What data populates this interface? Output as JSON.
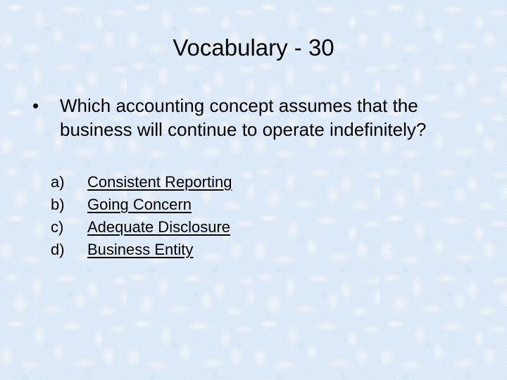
{
  "slide": {
    "title": "Vocabulary - 30",
    "background_color": "#dbe8f7",
    "text_color": "#000000"
  },
  "question": {
    "bullet_glyph": "•",
    "text": "Which accounting concept assumes that the business will continue to operate indefinitely?"
  },
  "options": [
    {
      "marker": "a)",
      "label": "Consistent Reporting"
    },
    {
      "marker": "b)",
      "label": "Going Concern"
    },
    {
      "marker": "c)",
      "label": "Adequate Disclosure"
    },
    {
      "marker": "d)",
      "label": "Business Entity"
    }
  ]
}
